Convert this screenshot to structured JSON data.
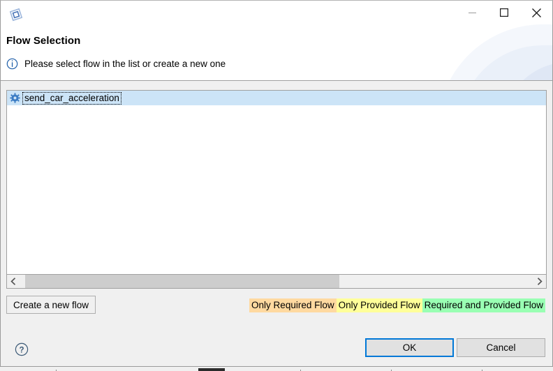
{
  "window": {
    "app_icon": "eclipse-diamond-icon",
    "controls": {
      "minimize": "minimize-icon",
      "maximize": "maximize-icon",
      "close": "close-icon"
    }
  },
  "header": {
    "title": "Flow Selection",
    "info_icon": "info-circle-icon",
    "description": "Please select flow in the list or create a new one"
  },
  "list": {
    "items": [
      {
        "icon": "gear-icon",
        "label": "send_car_acceleration",
        "selected": true
      }
    ],
    "scrollbar": {
      "left_arrow": "chevron-left-icon",
      "right_arrow": "chevron-right-icon"
    }
  },
  "actions": {
    "create_flow_label": "Create a new flow",
    "ok_label": "OK",
    "cancel_label": "Cancel",
    "help_icon": "help-circle-icon"
  },
  "legend": {
    "items": [
      {
        "label": "Only Required Flow",
        "color": "#ffd9a0"
      },
      {
        "label": "Only Provided Flow",
        "color": "#ffff99"
      },
      {
        "label": "Required and Provided Flow",
        "color": "#99ffb3"
      }
    ]
  },
  "colors": {
    "selection": "#cce4f7",
    "accent": "#0078d7",
    "dialog_bg": "#f0f0f0",
    "panel_bg": "#ffffff"
  }
}
